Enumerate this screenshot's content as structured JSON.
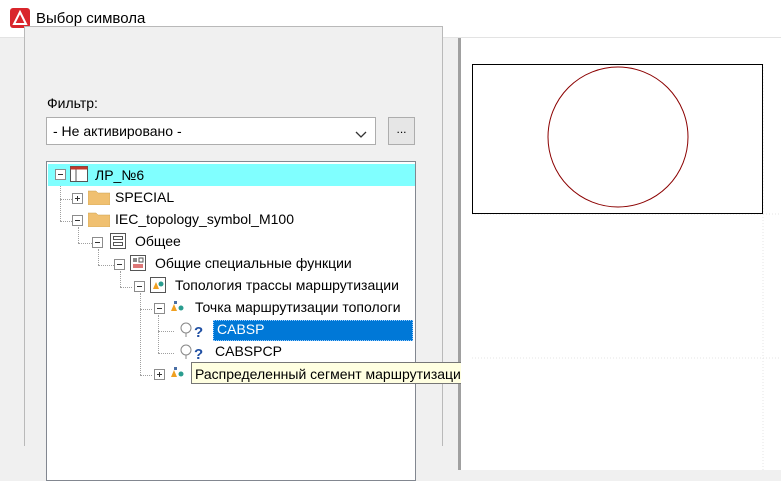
{
  "window": {
    "title": "Выбор символа"
  },
  "filter": {
    "label": "Фильтр:",
    "selected": "- Не активировано -",
    "browse_button": "..."
  },
  "tree": {
    "root": "ЛР_№6",
    "nodes": [
      {
        "label": "SPECIAL"
      },
      {
        "label": "IEC_topology_symbol_M100"
      },
      {
        "label": "Общее"
      },
      {
        "label": "Общие специальные функции"
      },
      {
        "label": "Топология трассы маршрутизации"
      },
      {
        "label": "Точка маршрутизации топологи"
      },
      {
        "label": "CABSP"
      },
      {
        "label": "CABSPCP"
      }
    ]
  },
  "tooltip": "Распределенный сегмент маршрутизации топологии",
  "colors": {
    "root_highlight": "#80ffff",
    "selection": "#0078d7",
    "circle_stroke": "#8b0000"
  }
}
